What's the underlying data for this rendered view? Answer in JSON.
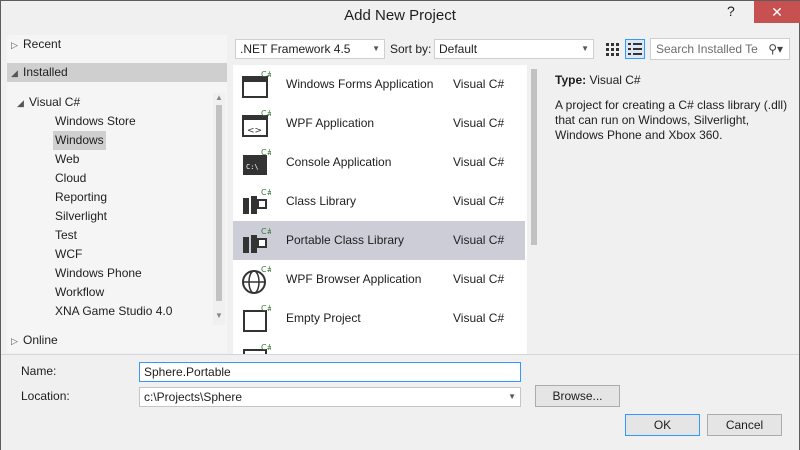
{
  "window": {
    "title": "Add New Project",
    "help_glyph": "?",
    "close_glyph": "✕"
  },
  "tree": {
    "recent": "Recent",
    "installed": "Installed",
    "visual_csharp": "Visual C#",
    "children": [
      "Windows Store",
      "Windows",
      "Web",
      "Cloud",
      "Reporting",
      "Silverlight",
      "Test",
      "WCF",
      "Windows Phone",
      "Workflow",
      "XNA Game Studio 4.0"
    ],
    "selected_child": "Windows",
    "online": "Online"
  },
  "toolbar": {
    "framework": ".NET Framework 4.5",
    "sort_label": "Sort by:",
    "sort_value": "Default",
    "search_placeholder": "Search Installed Te"
  },
  "templates": [
    {
      "name": "Windows Forms Application",
      "lang": "Visual C#",
      "icon": "winforms-icon"
    },
    {
      "name": "WPF Application",
      "lang": "Visual C#",
      "icon": "wpf-icon"
    },
    {
      "name": "Console Application",
      "lang": "Visual C#",
      "icon": "console-icon"
    },
    {
      "name": "Class Library",
      "lang": "Visual C#",
      "icon": "class-library-icon"
    },
    {
      "name": "Portable Class Library",
      "lang": "Visual C#",
      "icon": "portable-library-icon",
      "selected": true
    },
    {
      "name": "WPF Browser Application",
      "lang": "Visual C#",
      "icon": "globe-icon"
    },
    {
      "name": "Empty Project",
      "lang": "Visual C#",
      "icon": "empty-project-icon"
    }
  ],
  "description": {
    "type_label": "Type:",
    "type_value": "Visual C#",
    "text": "A project for creating a C# class library (.dll) that can run on Windows, Silverlight, Windows Phone and Xbox 360."
  },
  "form": {
    "name_label": "Name:",
    "name_value": "Sphere.Portable",
    "location_label": "Location:",
    "location_value": "c:\\Projects\\Sphere",
    "browse_label": "Browse...",
    "ok_label": "OK",
    "cancel_label": "Cancel"
  },
  "colors": {
    "selection": "#cdcdd8",
    "tree_selection": "#cfcfcf",
    "close_button": "#c75050",
    "focus_border": "#3399ff"
  }
}
